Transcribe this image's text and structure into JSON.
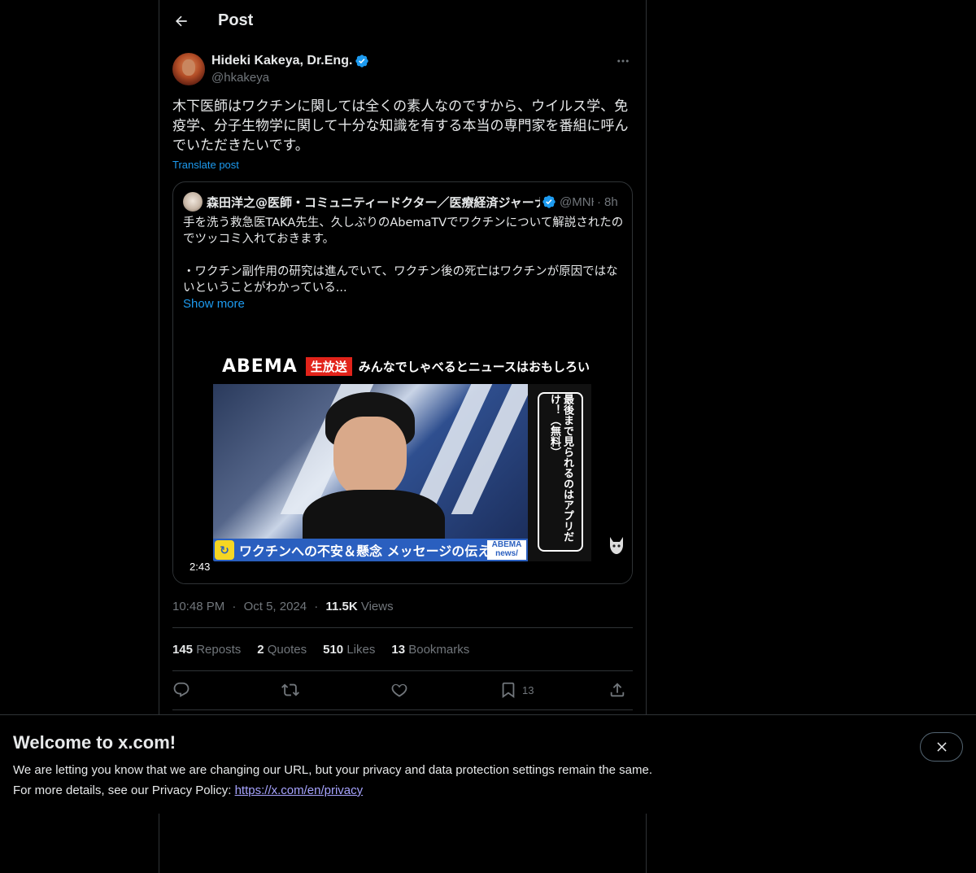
{
  "header": {
    "title": "Post",
    "back_icon": "arrow-left-icon"
  },
  "author": {
    "display_name": "Hideki Kakeya, Dr.Eng.",
    "handle": "@hkakeya",
    "verified_color": "#1d9bf0"
  },
  "post": {
    "text": "木下医師はワクチンに関しては全くの素人なのですから、ウイルス学、免疫学、分子生物学に関して十分な知識を有する本当の専門家を番組に呼んでいただきたいです。",
    "translate_label": "Translate post"
  },
  "quote": {
    "name": "森田洋之@医師・コミュニティードクター／医療経済ジャーナリスト",
    "handle": "@MNHR_Labo",
    "separator": "·",
    "time": "8h",
    "para1": "手を洗う救急医TAKA先生、久しぶりのAbemaTVでワクチンについて解説されたのでツッコミ入れておきます。",
    "para2": "・ワクチン副作用の研究は進んでいて、ワクチン後の死亡はワクチンが原因ではないということがわかっている...",
    "show_more": "Show more",
    "video": {
      "logo": "ABEMA",
      "live_badge": "生放送",
      "show_title": "みんなでしゃべるとニュースはおもしろい",
      "caption": "ワクチンへの不安＆懸念 メッセージの伝え方",
      "caption_news": "ABEMA news/",
      "side_text": "最後まで見られるのはアプリだけ！（無料）",
      "duration": "2:43"
    }
  },
  "meta": {
    "time": "10:48 PM",
    "dot": "·",
    "date": "Oct 5, 2024",
    "views_count": "11.5K",
    "views_label": "Views"
  },
  "stats": {
    "reposts_count": "145",
    "reposts_label": "Reposts",
    "quotes_count": "2",
    "quotes_label": "Quotes",
    "likes_count": "510",
    "likes_label": "Likes",
    "bookmarks_count": "13",
    "bookmarks_label": "Bookmarks"
  },
  "actions": {
    "bookmark_count": "13"
  },
  "banner": {
    "title": "Welcome to x.com!",
    "line1": "We are letting you know that we are changing our URL, but your privacy and data protection settings remain the same.",
    "line2_prefix": "For more details, see our Privacy Policy: ",
    "link": "https://x.com/en/privacy"
  },
  "colors": {
    "accent": "#1d9bf0",
    "background": "#000000",
    "border": "#2f3336",
    "muted": "#71767b",
    "link": "#a7a4ff"
  }
}
